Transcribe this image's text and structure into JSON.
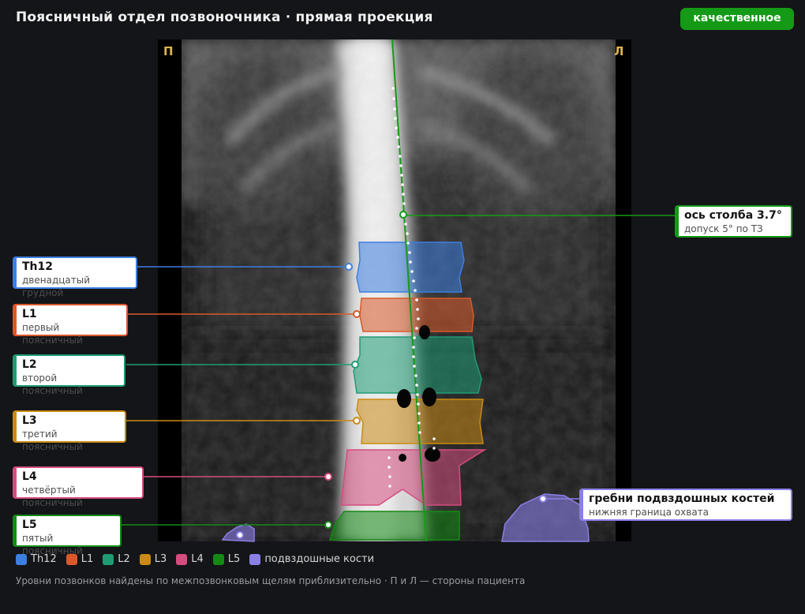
{
  "title": "Поясничный отдел позвоночника · прямая проекция",
  "badge": "качественное",
  "sides": {
    "right": "П",
    "left": "Л"
  },
  "axis": {
    "label": "ось столба 3.7°",
    "sub": "допуск 5° по ТЗ",
    "color": "#159a17"
  },
  "vertebrae": [
    {
      "name": "Th12",
      "desc": "двенадцатый грудной",
      "color": "#3d7fe0"
    },
    {
      "name": "L1",
      "desc": "первый поясничный",
      "color": "#d9592a"
    },
    {
      "name": "L2",
      "desc": "второй поясничный",
      "color": "#1f9c74"
    },
    {
      "name": "L3",
      "desc": "третий поясничный",
      "color": "#c98b14"
    },
    {
      "name": "L4",
      "desc": "четвёртый поясничный",
      "color": "#d64c7f"
    },
    {
      "name": "L5",
      "desc": "пятый поясничный",
      "color": "#148a14"
    }
  ],
  "iliac": {
    "name": "гребни подвздошных костей",
    "desc": "нижняя граница охвата",
    "color": "#8a7fe6"
  },
  "legend": [
    {
      "label": "Th12",
      "color": "#3d7fe0",
      "icon": "square-swatch"
    },
    {
      "label": "L1",
      "color": "#d9592a",
      "icon": "square-swatch"
    },
    {
      "label": "L2",
      "color": "#1f9c74",
      "icon": "square-swatch"
    },
    {
      "label": "L3",
      "color": "#c98b14",
      "icon": "square-swatch"
    },
    {
      "label": "L4",
      "color": "#d64c7f",
      "icon": "square-swatch"
    },
    {
      "label": "L5",
      "color": "#148a14",
      "icon": "square-swatch"
    },
    {
      "label": "подвздошные кости",
      "color": "#8a7fe6",
      "icon": "square-swatch"
    }
  ],
  "note": "Уровни позвонков найдены по межпозвонковым щелям приблизительно · П и Л — стороны пациента"
}
